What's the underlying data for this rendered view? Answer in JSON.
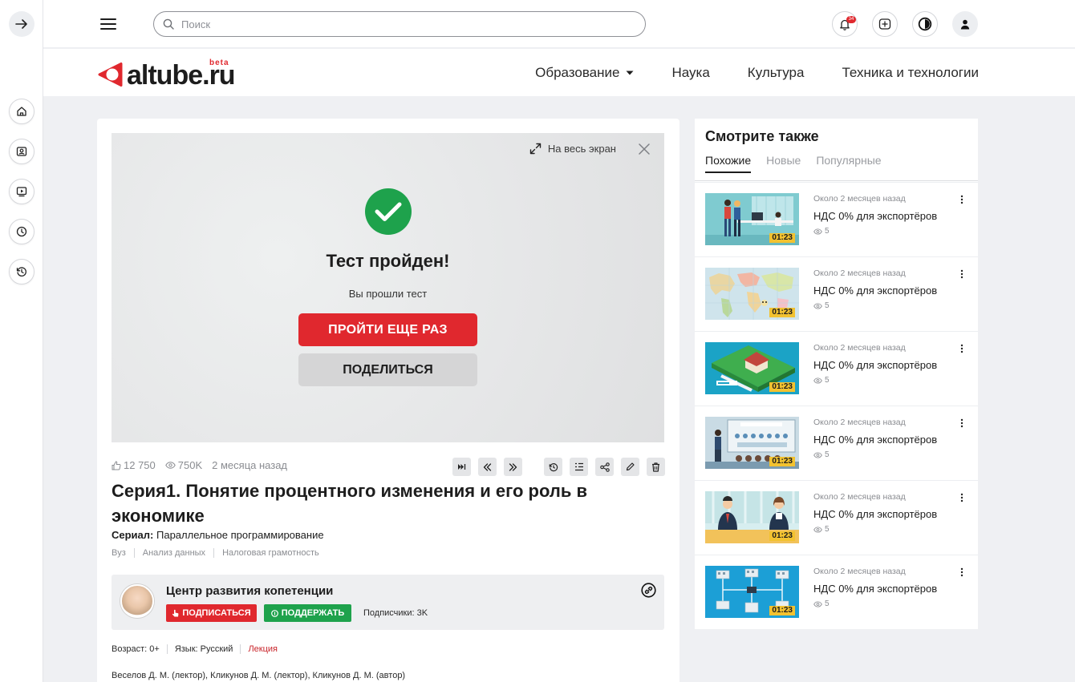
{
  "search": {
    "placeholder": "Поиск"
  },
  "notifications": {
    "count": "34"
  },
  "logo": {
    "text": "altube.ru",
    "beta": "beta"
  },
  "nav": [
    {
      "label": "Образование",
      "has_dropdown": true
    },
    {
      "label": "Наука"
    },
    {
      "label": "Культура"
    },
    {
      "label": "Техника и технологии"
    }
  ],
  "player": {
    "fullscreen_label": "На весь экран",
    "result_title": "Тест пройден!",
    "result_subtitle": "Вы прошли тест",
    "retry_label": "ПРОЙТИ ЕЩЕ РАЗ",
    "share_label": "ПОДЕЛИТЬСЯ"
  },
  "video": {
    "likes": "12 750",
    "views": "750K",
    "age": "2 месяца назад",
    "title": "Серия1. Понятие процентного изменения и его роль в экономике",
    "series_label": "Сериал:",
    "series_value": "Параллельное программирование",
    "tags": [
      "Вуз",
      "Анализ данных",
      "Налоговая грамотность"
    ],
    "meta": {
      "age_rating": "Возраст: 0+",
      "language": "Язык: Русский",
      "type": "Лекция"
    },
    "authors": "Веселов Д. М. (лектор), Кликунов Д. М. (лектор), Кликунов Д. М. (автор)"
  },
  "channel": {
    "name": "Центр развития копетенции",
    "subscribe_label": "ПОДПИСАТЬСЯ",
    "support_label": "ПОДДЕРЖАТЬ",
    "subscribers": "Подписчики: 3K"
  },
  "sidebar": {
    "title": "Смотрите также",
    "tabs": [
      "Похожие",
      "Новые",
      "Популярные"
    ],
    "active_tab": "Похожие",
    "videos": [
      {
        "date": "Около 2 месяцев назад",
        "title": "НДС 0% для экспортёров",
        "views": "5",
        "duration": "01:23"
      },
      {
        "date": "Около 2 месяцев назад",
        "title": "НДС 0% для экспортёров",
        "views": "5",
        "duration": "01:23"
      },
      {
        "date": "Около 2 месяцев назад",
        "title": "НДС 0% для экспортёров",
        "views": "5",
        "duration": "01:23"
      },
      {
        "date": "Около 2 месяцев назад",
        "title": "НДС 0% для экспортёров",
        "views": "5",
        "duration": "01:23"
      },
      {
        "date": "Около 2 месяцев назад",
        "title": "НДС 0% для экспортёров",
        "views": "5",
        "duration": "01:23"
      },
      {
        "date": "Около 2 месяцев назад",
        "title": "НДС 0% для экспортёров",
        "views": "5",
        "duration": "01:23"
      }
    ]
  },
  "colors": {
    "brand_red": "#e0282e",
    "success_green": "#1ea24c",
    "duration_badge": "#f2c230"
  }
}
